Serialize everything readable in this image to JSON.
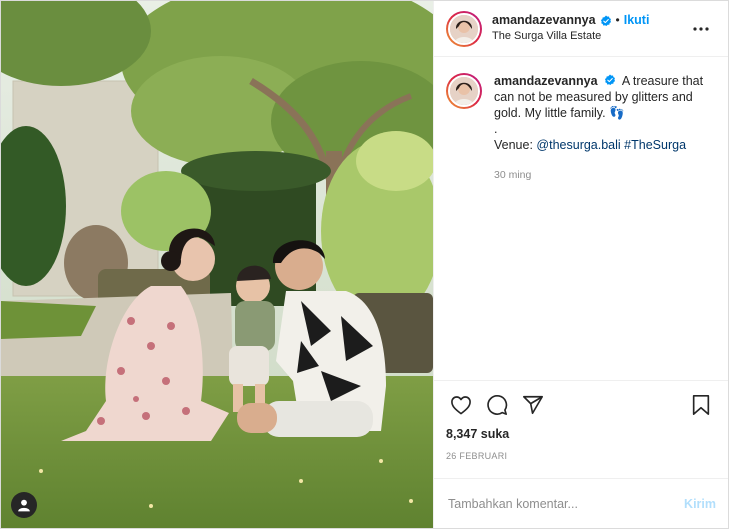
{
  "header": {
    "username": "amandazevannya",
    "verified": true,
    "separator": "•",
    "follow_label": "Ikuti",
    "location": "The Surga Villa Estate",
    "more_icon": "more-horizontal-icon"
  },
  "caption": {
    "username": "amandazevannya",
    "text": "A treasure that can not be measured by glitters and gold. My little family. 👣",
    "dot": ".",
    "venue_prefix": "Venue:",
    "venue_mention": "@thesurga.bali",
    "hashtag": "#TheSurga",
    "time_ago": "30 ming"
  },
  "actions": {
    "like_icon": "heart-icon",
    "comment_icon": "comment-icon",
    "share_icon": "send-icon",
    "save_icon": "bookmark-icon",
    "likes_text": "8,347 suka",
    "date": "26 FEBRUARI"
  },
  "comment": {
    "placeholder": "Tambahkan komentar...",
    "post_label": "Kirim"
  },
  "photo": {
    "user_tag_icon": "user-tag-icon"
  },
  "colors": {
    "accent": "#0095f6",
    "link": "#00376b",
    "muted": "#8e8e8e",
    "post_disabled": "#b2dffc"
  }
}
